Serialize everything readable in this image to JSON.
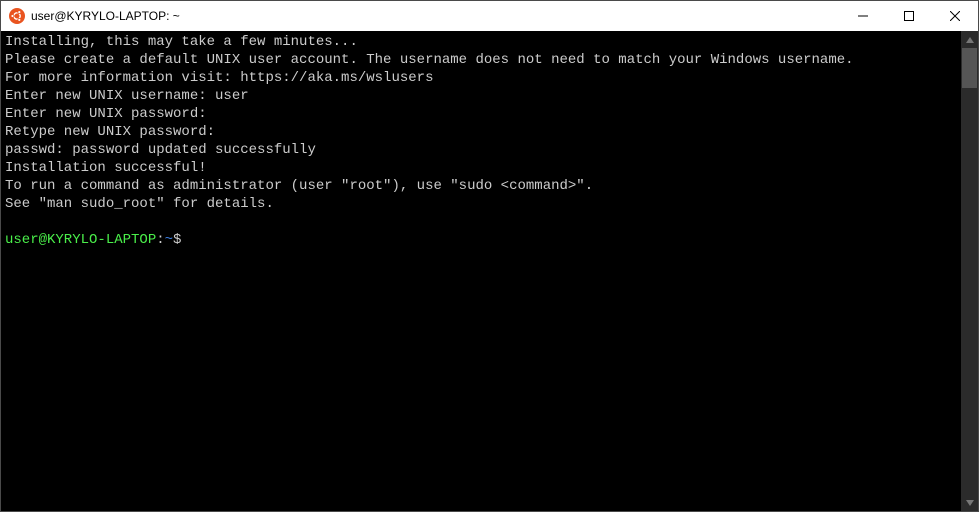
{
  "window": {
    "title": "user@KYRYLO-LAPTOP: ~"
  },
  "terminal": {
    "lines": [
      "Installing, this may take a few minutes...",
      "Please create a default UNIX user account. The username does not need to match your Windows username.",
      "For more information visit: https://aka.ms/wslusers",
      "Enter new UNIX username: user",
      "Enter new UNIX password:",
      "Retype new UNIX password:",
      "passwd: password updated successfully",
      "Installation successful!",
      "To run a command as administrator (user \"root\"), use \"sudo <command>\".",
      "See \"man sudo_root\" for details.",
      ""
    ],
    "prompt": {
      "user": "user@KYRYLO-LAPTOP",
      "colon": ":",
      "path": "~",
      "symbol": "$"
    }
  }
}
